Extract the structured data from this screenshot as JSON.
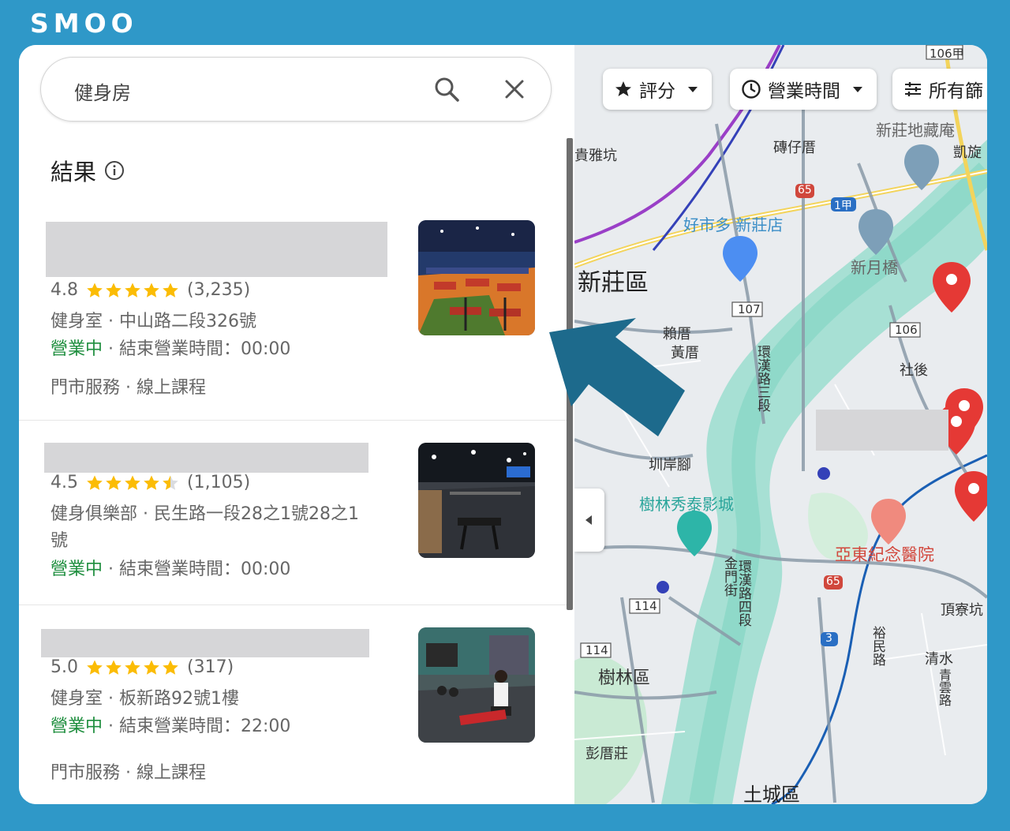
{
  "brand": "SMOO",
  "search": {
    "query": "健身房",
    "search_icon": "search-icon",
    "clear_icon": "close-icon"
  },
  "results_header": {
    "title": "結果",
    "info_icon": "info-icon"
  },
  "results": [
    {
      "rating": "4.8",
      "stars": 5,
      "reviews": "(3,235)",
      "category_address": "健身室 · 中山路二段326號",
      "status_open": "營業中",
      "status_rest": " · 結束營業時間：00:00",
      "services": "門市服務 · 線上課程"
    },
    {
      "rating": "4.5",
      "stars": 4.5,
      "reviews": "(1,105)",
      "category_address": "健身俱樂部 · 民生路一段28之1號28之1",
      "category_address_2": "號",
      "status_open": "營業中",
      "status_rest": " · 結束營業時間：00:00"
    },
    {
      "rating": "5.0",
      "stars": 5,
      "reviews": "(317)",
      "category_address": "健身室 · 板新路92號1樓",
      "status_open": "營業中",
      "status_rest": " · 結束營業時間：22:00",
      "services": "門市服務 · 線上課程"
    }
  ],
  "map": {
    "filters": [
      {
        "label": "評分",
        "icon": "star-icon"
      },
      {
        "label": "營業時間",
        "icon": "clock-icon"
      },
      {
        "label": "所有篩",
        "icon": "sliders-icon"
      }
    ],
    "labels": {
      "xinzhuang": "新莊區",
      "costco": "好市多 新莊店",
      "shulin_district": "樹林區",
      "shulin_cinema": "樹林秀泰影城",
      "hospital": "亞東紀念醫院",
      "tucheng": "土城區",
      "penglicuo": "彭厝莊",
      "zhuanzaicuo": "磚仔厝",
      "dizang": "新莊地藏庵",
      "kaixuan": "凱旋",
      "xinyue_bridge": "新月橋",
      "laicuo": "賴厝",
      "huangcuo": "黃厝",
      "shehou": "社後",
      "kanan": "圳岸腳",
      "dingliaokeng": "頂寮坑",
      "qingshui": "清水",
      "huanhe3": "環漢路三段",
      "huanhe4": "環漢路四段",
      "jinmen": "金門街",
      "yumin": "裕民路",
      "qingyun": "青雲路",
      "guiyakeng": "貴雅坑",
      "road_106jia": "106甲",
      "road_107": "107",
      "road_106": "106",
      "road_114a": "114",
      "road_114b": "114",
      "road_65a": "65",
      "road_65b": "65",
      "road_1jia": "1甲",
      "road_3": "3"
    }
  },
  "colors": {
    "background": "#2f98c8",
    "open_green": "#1e8e3e",
    "star": "#fbbc04",
    "arrow": "#1d6a8c",
    "pin_red": "#e53935"
  }
}
